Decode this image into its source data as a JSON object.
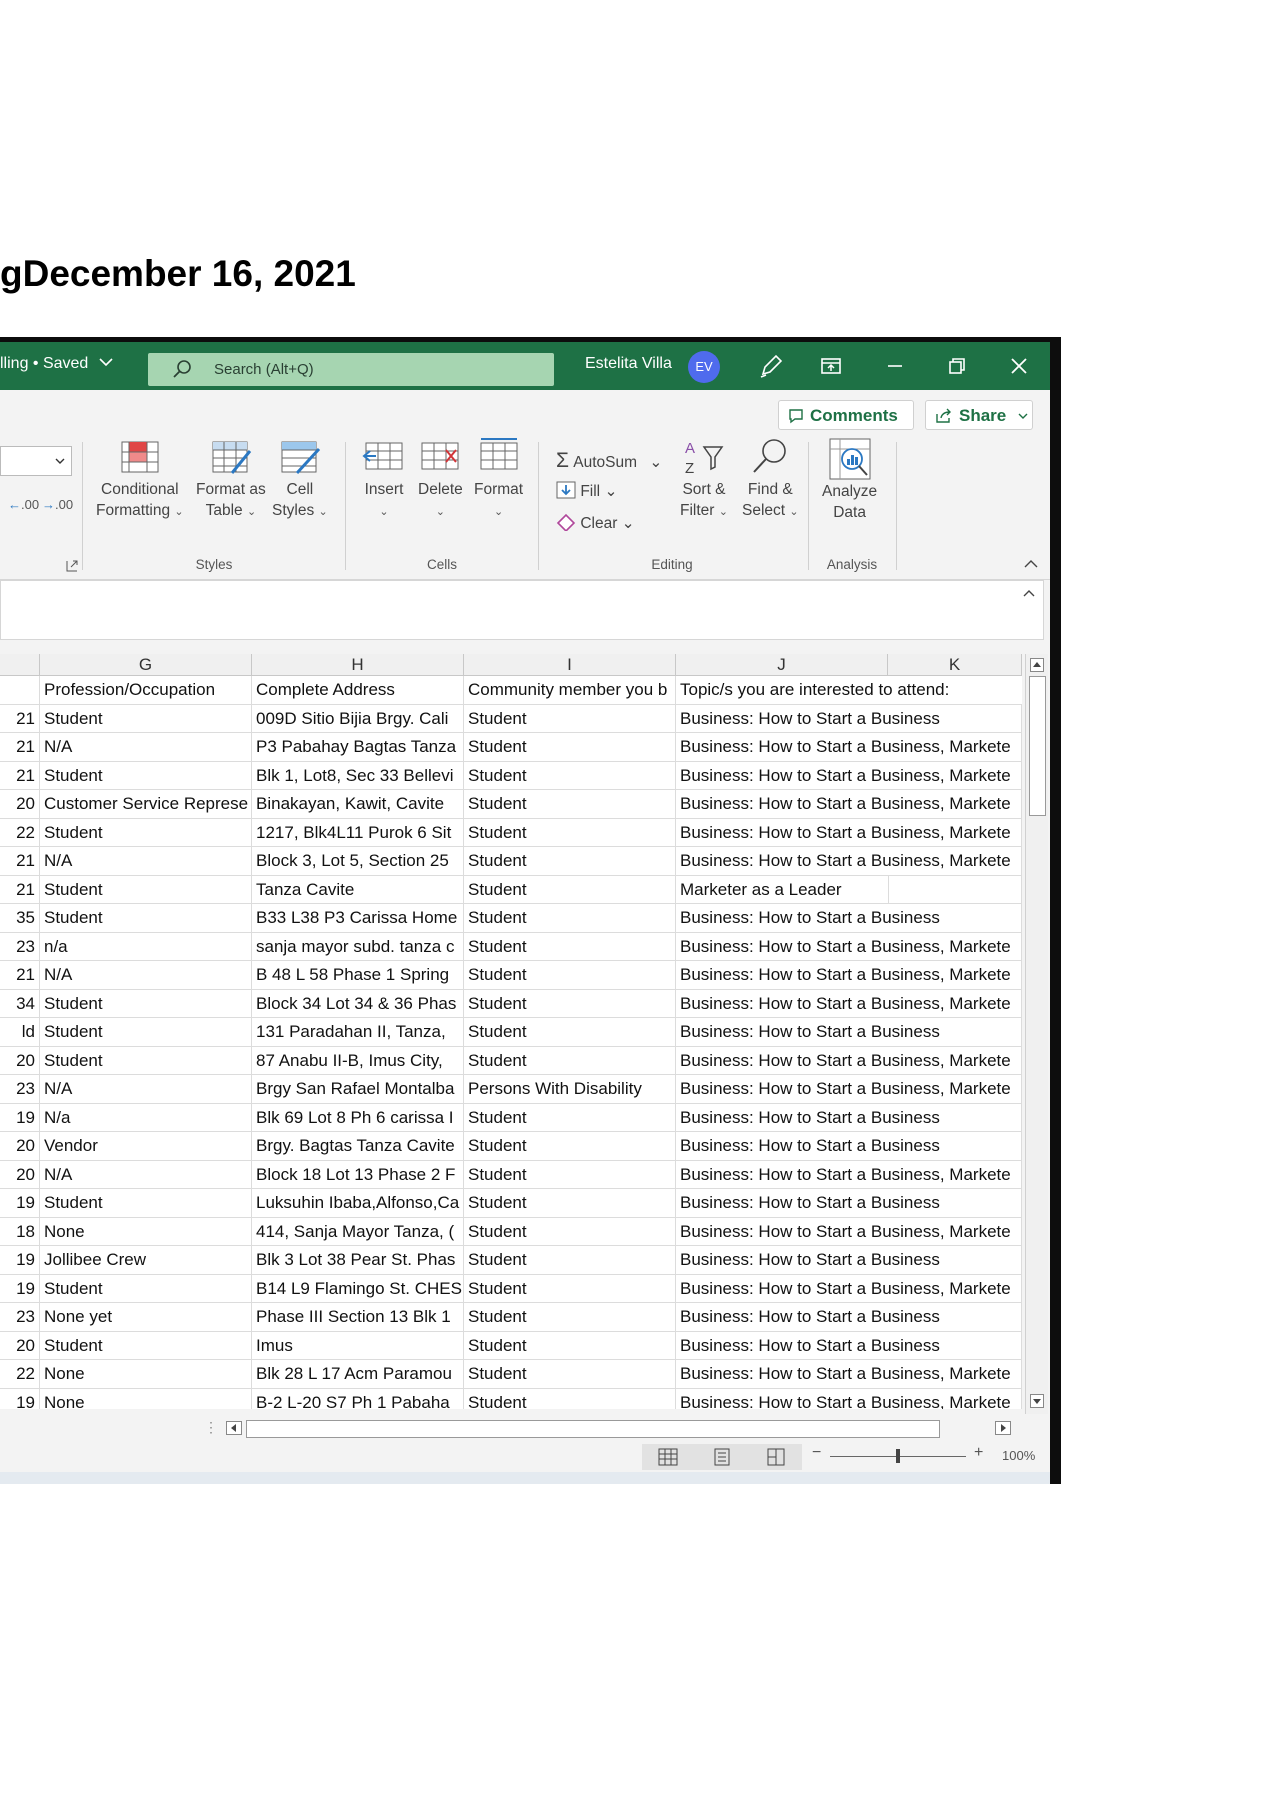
{
  "document": {
    "heading": "gDecember 16, 2021"
  },
  "titlebar": {
    "file_status": "lling • Saved",
    "search_placeholder": "Search (Alt+Q)",
    "user_name": "Estelita Villa",
    "user_initials": "EV"
  },
  "actions": {
    "comments_label": "Comments",
    "share_label": "Share"
  },
  "ribbon": {
    "number_format": {
      "increase_decimal": ".00",
      "decrease_decimal": ".00"
    },
    "styles": {
      "conditional_formatting": [
        "Conditional",
        "Formatting"
      ],
      "format_as_table": [
        "Format as",
        "Table"
      ],
      "cell_styles": [
        "Cell",
        "Styles"
      ],
      "group_label": "Styles"
    },
    "cells": {
      "insert": "Insert",
      "delete": "Delete",
      "format": "Format",
      "group_label": "Cells"
    },
    "editing": {
      "autosum": "AutoSum",
      "fill": "Fill",
      "clear": "Clear",
      "sort_filter": [
        "Sort &",
        "Filter"
      ],
      "find_select": [
        "Find &",
        "Select"
      ],
      "group_label": "Editing"
    },
    "analysis": {
      "analyze_data": [
        "Analyze",
        "Data"
      ],
      "group_label": "Analysis"
    }
  },
  "sheet": {
    "columns": [
      "G",
      "H",
      "I",
      "J",
      "K"
    ],
    "header_row": {
      "F": "",
      "G": "Profession/Occupation",
      "H": "Complete Address",
      "I": "Community member you b",
      "J": "Topic/s you are interested to attend:"
    },
    "rows": [
      {
        "F": "21",
        "G": "Student",
        "H": "009D Sitio Bijia Brgy. Cali",
        "I": "Student",
        "J": "Business: How to Start a Business"
      },
      {
        "F": "21",
        "G": "N/A",
        "H": "P3 Pabahay Bagtas Tanza",
        "I": "Student",
        "J": "Business: How to Start a Business, Markete"
      },
      {
        "F": "21",
        "G": "Student",
        "H": "Blk 1, Lot8, Sec 33 Bellevi",
        "I": "Student",
        "J": "Business: How to Start a Business, Markete"
      },
      {
        "F": "20",
        "G": "Customer Service Represe",
        "H": "Binakayan, Kawit, Cavite",
        "I": "Student",
        "J": "Business: How to Start a Business, Markete"
      },
      {
        "F": "22",
        "G": "Student",
        "H": "1217, Blk4L11 Purok 6 Sit",
        "I": "Student",
        "J": "Business: How to Start a Business, Markete"
      },
      {
        "F": "21",
        "G": "N/A",
        "H": "Block 3, Lot 5, Section 25",
        "I": "Student",
        "J": "Business: How to Start a Business, Markete"
      },
      {
        "F": "21",
        "G": "Student",
        "H": "Tanza Cavite",
        "I": "Student",
        "J": "Marketer as a Leader"
      },
      {
        "F": "35",
        "G": "Student",
        "H": "B33 L38 P3 Carissa Home",
        "I": "Student",
        "J": "Business: How to Start a Business"
      },
      {
        "F": "23",
        "G": "n/a",
        "H": "sanja mayor subd. tanza c",
        "I": "Student",
        "J": "Business: How to Start a Business, Markete"
      },
      {
        "F": "21",
        "G": "N/A",
        "H": "B 48 L 58 Phase 1 Spring",
        "I": "Student",
        "J": "Business: How to Start a Business, Markete"
      },
      {
        "F": "34",
        "G": "Student",
        "H": "Block 34 Lot 34 & 36 Phas",
        "I": "Student",
        "J": "Business: How to Start a Business, Markete"
      },
      {
        "F": "ld",
        "G": "Student",
        "H": "131 Paradahan II, Tanza,",
        "I": "Student",
        "J": "Business: How to Start a Business"
      },
      {
        "F": "20",
        "G": "Student",
        "H": "87 Anabu II-B, Imus City,",
        "I": "Student",
        "J": "Business: How to Start a Business, Markete"
      },
      {
        "F": "23",
        "G": "N/A",
        "H": "Brgy San Rafael Montalba",
        "I": "Persons With Disability",
        "J": "Business: How to Start a Business, Markete"
      },
      {
        "F": "19",
        "G": "N/a",
        "H": "Blk 69 Lot 8 Ph 6 carissa I",
        "I": "Student",
        "J": "Business: How to Start a Business"
      },
      {
        "F": "20",
        "G": "Vendor",
        "H": "Brgy. Bagtas Tanza Cavite",
        "I": "Student",
        "J": "Business: How to Start a Business"
      },
      {
        "F": "20",
        "G": "N/A",
        "H": "Block 18 Lot 13 Phase 2 F",
        "I": "Student",
        "J": "Business: How to Start a Business, Markete"
      },
      {
        "F": "19",
        "G": "Student",
        "H": "Luksuhin Ibaba,Alfonso,Ca",
        "I": "Student",
        "J": "Business: How to Start a Business"
      },
      {
        "F": "18",
        "G": "None",
        "H": "414, Sanja Mayor Tanza, (",
        "I": "Student",
        "J": "Business: How to Start a Business, Markete"
      },
      {
        "F": "19",
        "G": "Jollibee Crew",
        "H": "Blk 3 Lot 38 Pear St. Phas",
        "I": "Student",
        "J": "Business: How to Start a Business"
      },
      {
        "F": "19",
        "G": "Student",
        "H": "B14 L9 Flamingo St. CHES",
        "I": "Student",
        "J": "Business: How to Start a Business, Markete"
      },
      {
        "F": "23",
        "G": "None yet",
        "H": "Phase III Section 13 Blk 1",
        "I": "Student",
        "J": "Business: How to Start a Business"
      },
      {
        "F": "20",
        "G": "Student",
        "H": "Imus",
        "I": "Student",
        "J": "Business: How to Start a Business"
      },
      {
        "F": "22",
        "G": "None",
        "H": "Blk 28 L 17 Acm Paramou",
        "I": "Student",
        "J": "Business: How to Start a Business, Markete"
      },
      {
        "F": "19",
        "G": "None",
        "H": "B-2 L-20 S7 Ph 1 Pabaha",
        "I": "Student",
        "J": "Business: How to Start a Business, Markete"
      }
    ]
  },
  "statusbar": {
    "zoom": "100%"
  }
}
